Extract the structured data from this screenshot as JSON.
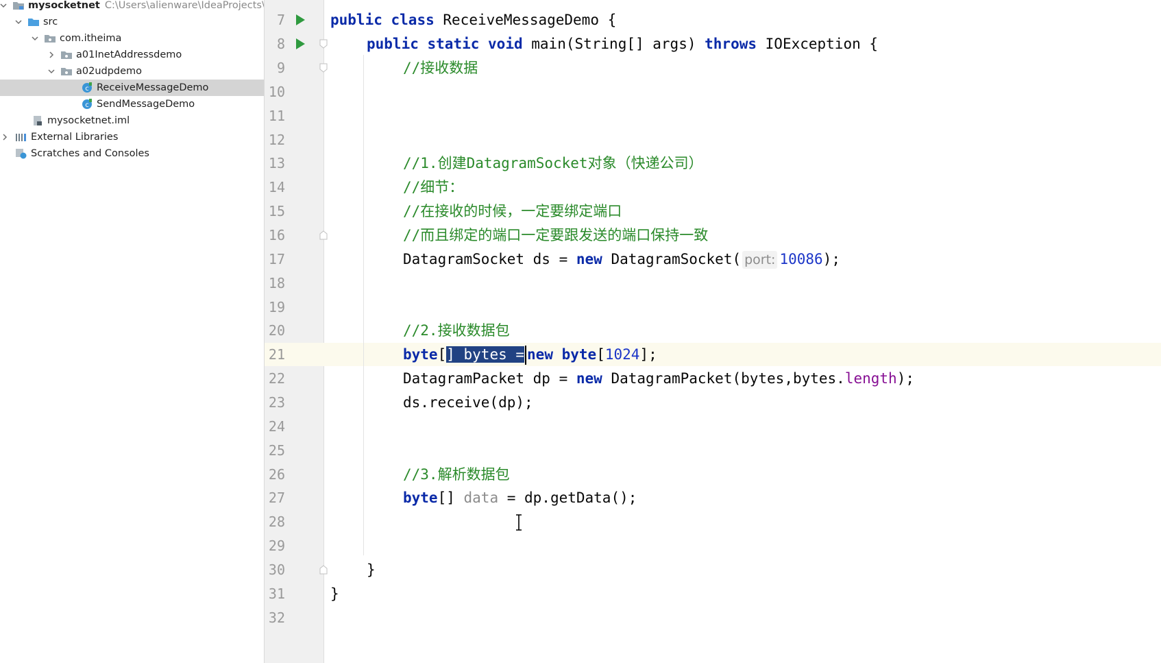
{
  "project_tree": {
    "root": {
      "name": "mysocketnet",
      "path": "C:\\Users\\alienware\\IdeaProjects\\ba"
    },
    "items": [
      {
        "label": "src"
      },
      {
        "label": "com.itheima"
      },
      {
        "label": "a01InetAddressdemo"
      },
      {
        "label": "a02udpdemo"
      },
      {
        "label": "ReceiveMessageDemo",
        "selected": true
      },
      {
        "label": "SendMessageDemo"
      },
      {
        "label": "mysocketnet.iml"
      },
      {
        "label": "External Libraries"
      },
      {
        "label": "Scratches and Consoles"
      }
    ]
  },
  "editor": {
    "line_numbers": [
      "7",
      "8",
      "9",
      "10",
      "11",
      "12",
      "13",
      "14",
      "15",
      "16",
      "17",
      "18",
      "19",
      "20",
      "21",
      "22",
      "23",
      "24",
      "25",
      "26",
      "27",
      "28",
      "29",
      "30",
      "31",
      "32"
    ],
    "current_line": "21",
    "code": {
      "l7": {
        "kw1": "public",
        "kw2": "class",
        "name": "ReceiveMessageDemo {"
      },
      "l8": {
        "kw1": "public",
        "kw2": "static",
        "kw3": "void",
        "sig": "main(String[] args)",
        "kw4": "throws",
        "rest": "IOException {"
      },
      "l9": "//接收数据",
      "l13": "//1.创建DatagramSocket对象（快递公司）",
      "l14": "//细节：",
      "l15": "//在接收的时候，一定要绑定端口",
      "l16": "//而且绑定的端口一定要跟发送的端口保持一致",
      "l17": {
        "pre": "DatagramSocket ds = ",
        "kw": "new",
        "ctor": " DatagramSocket(",
        "hint": "port:",
        "num": "10086",
        "end": ");"
      },
      "l20": "//2.接收数据包",
      "l21": {
        "kw1": "byte",
        "br1": "[",
        "sel": "] bytes =",
        "kw2": "new",
        "kw3": "byte",
        "br2": "[",
        "num": "1024",
        "end": "];"
      },
      "l22": {
        "pre": "DatagramPacket dp = ",
        "kw": "new",
        "mid": " DatagramPacket(bytes,bytes.",
        "field": "length",
        "end": ");"
      },
      "l23": "ds.receive(dp);",
      "l26": "//3.解析数据包",
      "l27": {
        "kw": "byte",
        "mid": "[] ",
        "var": "data",
        "end": " = dp.getData();"
      },
      "l30": "}",
      "l31": "}"
    }
  }
}
